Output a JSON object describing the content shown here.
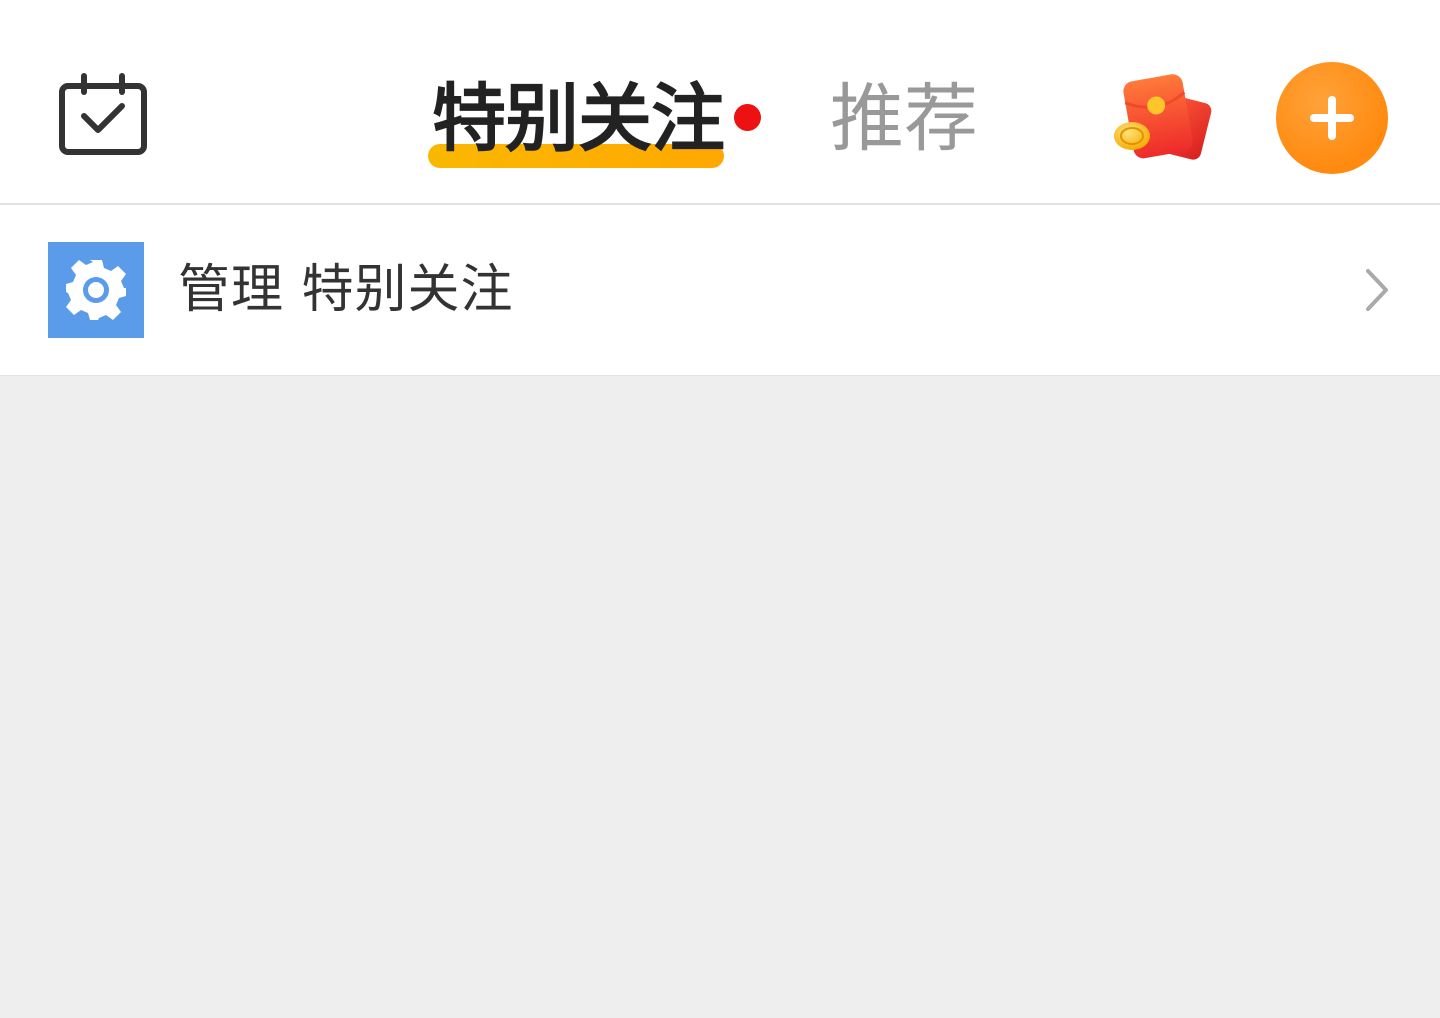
{
  "header": {
    "tabs": [
      {
        "label": "特别关注",
        "active": true,
        "badge_dot": true
      },
      {
        "label": "推荐",
        "active": false
      }
    ],
    "icons": {
      "left": "calendar-check-icon",
      "right_1": "red-packet-icon",
      "right_2": "plus-icon"
    },
    "colors": {
      "active_underline": "#FFB000",
      "badge_dot": "#EE1111",
      "add_button": "#FF8A0F",
      "inactive_tab": "#999999"
    }
  },
  "manage": {
    "label": "管理 特别关注",
    "icon": "gear-icon",
    "icon_bg": "#5A9BEA"
  }
}
